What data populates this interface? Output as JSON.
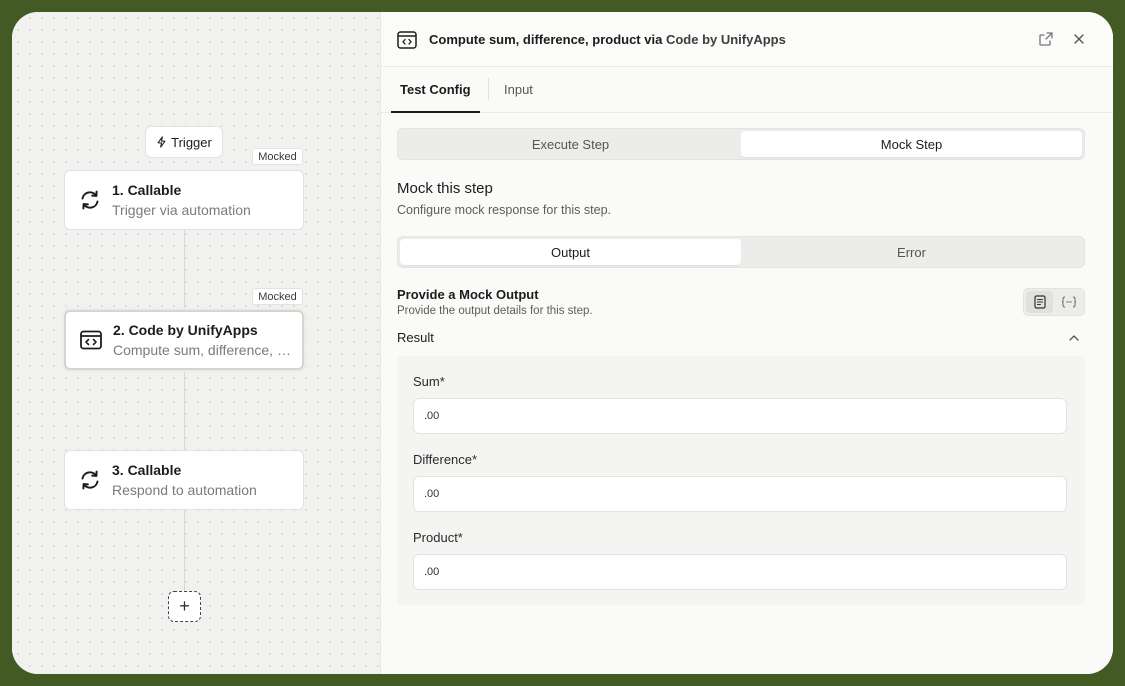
{
  "canvas": {
    "trigger_label": "Trigger",
    "nodes": [
      {
        "title": "1. Callable",
        "subtitle": "Trigger via automation",
        "badge": "Mocked",
        "icon": "refresh-icon"
      },
      {
        "title": "2. Code by UnifyApps",
        "subtitle": "Compute sum, difference, product",
        "badge": "Mocked",
        "icon": "code-window-icon"
      },
      {
        "title": "3. Callable",
        "subtitle": "Respond to automation",
        "icon": "refresh-icon"
      }
    ],
    "add_label": "+"
  },
  "panel": {
    "title_prefix": "Compute sum, difference, product via",
    "title_app": "Code by UnifyApps",
    "tabs": [
      "Test Config",
      "Input"
    ],
    "active_tab": "Test Config",
    "step_mode": {
      "options": [
        "Execute Step",
        "Mock Step"
      ],
      "selected": "Mock Step"
    },
    "mock_heading": "Mock this step",
    "mock_subheading": "Configure mock response for this step.",
    "response_type": {
      "options": [
        "Output",
        "Error"
      ],
      "selected": "Output"
    },
    "provide_title": "Provide a Mock Output",
    "provide_subtitle": "Provide the output details for this step.",
    "result_label": "Result",
    "fields": [
      {
        "label": "Sum*",
        "value": ".00"
      },
      {
        "label": "Difference*",
        "value": ".00"
      },
      {
        "label": "Product*",
        "value": ".00"
      }
    ]
  }
}
